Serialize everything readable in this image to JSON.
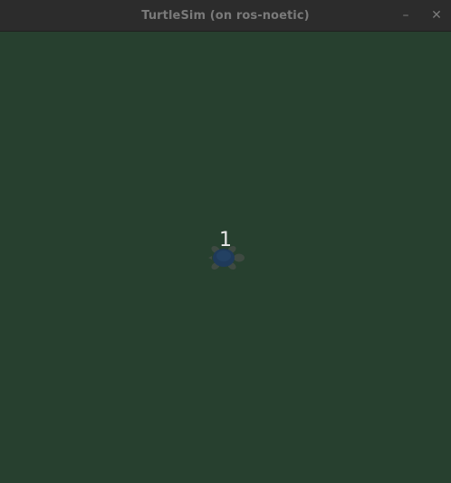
{
  "window": {
    "title": "TurtleSim (on ros-noetic)",
    "minimize_glyph": "–",
    "close_glyph": "✕"
  },
  "canvas": {
    "background_color": "#27402f"
  },
  "turtle": {
    "name": "1",
    "icon": "turtle-icon",
    "shell_color": "#1f3a5a",
    "body_color": "#3f4a42"
  }
}
